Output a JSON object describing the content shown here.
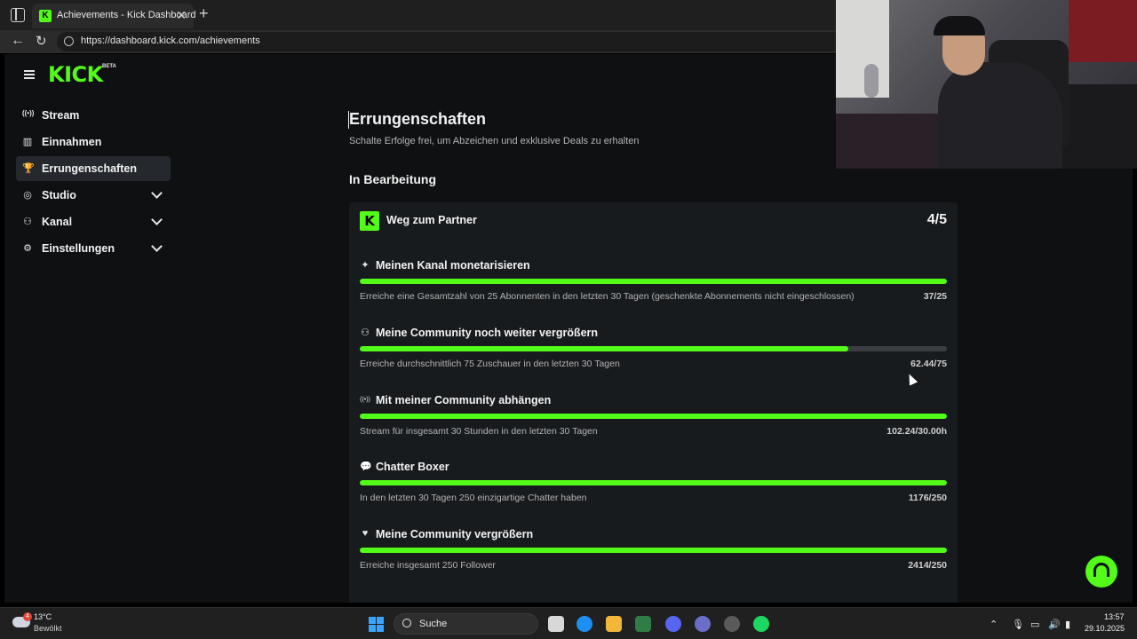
{
  "browser": {
    "tab_title": "Achievements - Kick Dashboard",
    "favicon_letter": "K",
    "url": "https://dashboard.kick.com/achievements",
    "close_glyph": "✕",
    "new_tab_glyph": "+",
    "back_glyph": "←",
    "reload_glyph": "↻"
  },
  "header": {
    "logo": "KICK",
    "logo_badge": "BETA"
  },
  "sidebar": {
    "items": [
      {
        "label": "Stream",
        "icon": "broadcast-icon",
        "glyph": "((•))",
        "active": false,
        "expandable": false
      },
      {
        "label": "Einnahmen",
        "icon": "chart-icon",
        "glyph": "▥",
        "active": false,
        "expandable": false
      },
      {
        "label": "Errungenschaften",
        "icon": "trophy-icon",
        "glyph": "🏆",
        "active": true,
        "expandable": false
      },
      {
        "label": "Studio",
        "icon": "camera-icon",
        "glyph": "◎",
        "active": false,
        "expandable": true
      },
      {
        "label": "Kanal",
        "icon": "users-icon",
        "glyph": "⚇",
        "active": false,
        "expandable": true
      },
      {
        "label": "Einstellungen",
        "icon": "gear-icon",
        "glyph": "⚙",
        "active": false,
        "expandable": true
      }
    ]
  },
  "main": {
    "title": "Errungenschaften",
    "subtitle": "Schalte Erfolge frei, um Abzeichen und exklusive Deals zu erhalten",
    "section_title": "In Bearbeitung",
    "card": {
      "logo_letter": "K",
      "title": "Weg zum Partner",
      "count": "4/5",
      "achievements": [
        {
          "icon": "sparkle-icon",
          "glyph": "✦",
          "title": "Meinen Kanal monetarisieren",
          "desc": "Erreiche eine Gesamtzahl von 25 Abonnenten in den letzten 30 Tagen (geschenkte Abonnements nicht eingeschlossen)",
          "value": "37/25",
          "progress": 1.0
        },
        {
          "icon": "users-icon",
          "glyph": "⚇",
          "title": "Meine Community noch weiter vergrößern",
          "desc": "Erreiche durchschnittlich 75 Zuschauer in den letzten 30 Tagen",
          "value": "62.44/75",
          "progress": 0.8325
        },
        {
          "icon": "broadcast-icon",
          "glyph": "((•))",
          "title": "Mit meiner Community abhängen",
          "desc": "Stream für insgesamt 30 Stunden in den letzten 30 Tagen",
          "value": "102.24/30.00h",
          "progress": 1.0
        },
        {
          "icon": "chat-icon",
          "glyph": "💬",
          "title": "Chatter Boxer",
          "desc": "In den letzten 30 Tagen 250 einzigartige Chatter haben",
          "value": "1176/250",
          "progress": 1.0
        },
        {
          "icon": "heart-icon",
          "glyph": "♥",
          "title": "Meine Community vergrößern",
          "desc": "Erreiche insgesamt 250 Follower",
          "value": "2414/250",
          "progress": 1.0
        }
      ]
    }
  },
  "colors": {
    "accent": "#53fc18",
    "background": "#0e1012",
    "card": "#181b1e"
  },
  "taskbar": {
    "weather_temp": "13°C",
    "weather_desc": "Bewölkt",
    "weather_badge": "4",
    "search_label": "Suche",
    "time": "13:57",
    "date": "29.10.2025"
  }
}
